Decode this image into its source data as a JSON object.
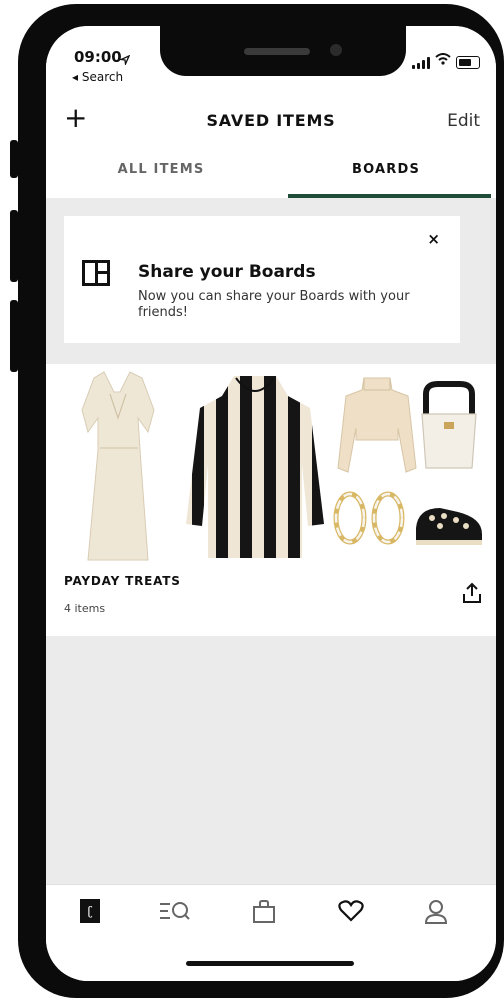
{
  "status_bar": {
    "time": "09:00",
    "back_label": "◂ Search"
  },
  "header": {
    "add_label": "+",
    "title": "SAVED ITEMS",
    "edit_label": "Edit"
  },
  "tabs": [
    {
      "label": "ALL ITEMS",
      "active": false
    },
    {
      "label": "BOARDS",
      "active": true
    }
  ],
  "share_banner": {
    "title": "Share your Boards",
    "text": "Now you can share your Boards with your friends!",
    "close_label": "×"
  },
  "board": {
    "name": "PAYDAY TREATS",
    "count": "4 items",
    "products": [
      "white-dress",
      "striped-hoodie",
      "cream-sweater",
      "bucket-bag",
      "hoop-earrings",
      "embellished-shoes"
    ]
  },
  "bottom_nav": [
    {
      "icon": "home-logo-icon",
      "active": false
    },
    {
      "icon": "search-list-icon",
      "active": false
    },
    {
      "icon": "bag-icon",
      "active": false
    },
    {
      "icon": "heart-icon",
      "active": true
    },
    {
      "icon": "account-icon",
      "active": false
    }
  ],
  "colors": {
    "accent": "#1f4d3a",
    "background": "#ebebeb"
  }
}
